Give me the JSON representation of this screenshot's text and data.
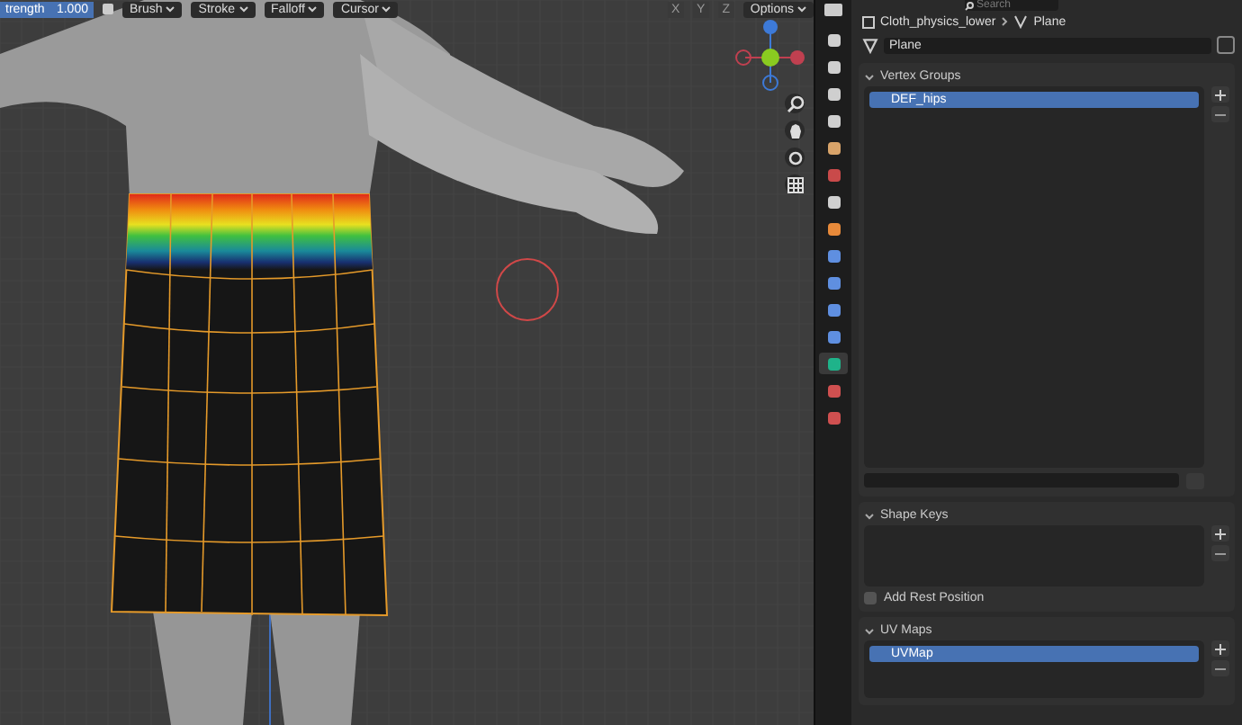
{
  "viewport_header": {
    "strength": {
      "label": "trength",
      "value": "1.000",
      "level": 1
    },
    "menus": [
      "Brush",
      "Stroke",
      "Falloff",
      "Cursor"
    ],
    "symmetry": [
      "X",
      "Y",
      "Z"
    ],
    "options": "Options"
  },
  "properties": {
    "search": {
      "placeholder": "Search"
    },
    "breadcrumb": [
      "Cloth_physics_lower",
      "Plane"
    ],
    "data_name": "Plane",
    "tabs": [
      {
        "kind": "tool",
        "selected": false
      },
      {
        "kind": "render",
        "selected": false
      },
      {
        "kind": "output",
        "selected": false
      },
      {
        "kind": "view",
        "selected": false
      },
      {
        "kind": "scene",
        "selected": false
      },
      {
        "kind": "world",
        "selected": false
      },
      {
        "kind": "collection",
        "selected": false
      },
      {
        "kind": "object",
        "selected": false
      },
      {
        "kind": "modifier",
        "selected": false
      },
      {
        "kind": "particles",
        "selected": false
      },
      {
        "kind": "physics",
        "selected": false
      },
      {
        "kind": "constraints",
        "selected": false
      },
      {
        "kind": "data",
        "selected": true
      },
      {
        "kind": "material",
        "selected": false
      },
      {
        "kind": "texture",
        "selected": false
      }
    ],
    "panels": [
      {
        "kind": "list",
        "title": "Vertex Groups",
        "expanded": true,
        "items": [
          {
            "name": "DEF_hips",
            "selected": true
          }
        ]
      },
      {
        "kind": "list",
        "title": "Shape Keys",
        "expanded": true,
        "checkbox": {
          "label": "Add Rest Position",
          "checked": false
        }
      },
      {
        "kind": "list",
        "title": "UV Maps",
        "expanded": true,
        "items": [
          {
            "name": "UVMap",
            "selected": true
          }
        ]
      }
    ]
  }
}
